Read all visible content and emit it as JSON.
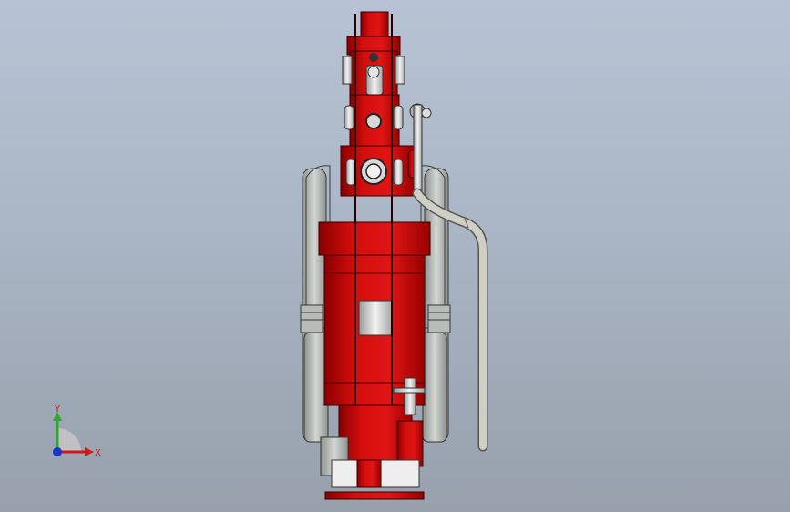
{
  "viewport": {
    "background_top": "#b7c3d4",
    "background_bottom": "#97a0ab"
  },
  "model": {
    "body_color": "#d40d0d",
    "dark_red": "#8a0000",
    "grey_part": "#c9cdc9",
    "hose_color": "#cfcfc4"
  },
  "triad": {
    "y_label": "Y",
    "x_label": "X",
    "y_color": "#2ea82e",
    "x_color": "#d01818",
    "origin_color": "#1a33c8"
  }
}
